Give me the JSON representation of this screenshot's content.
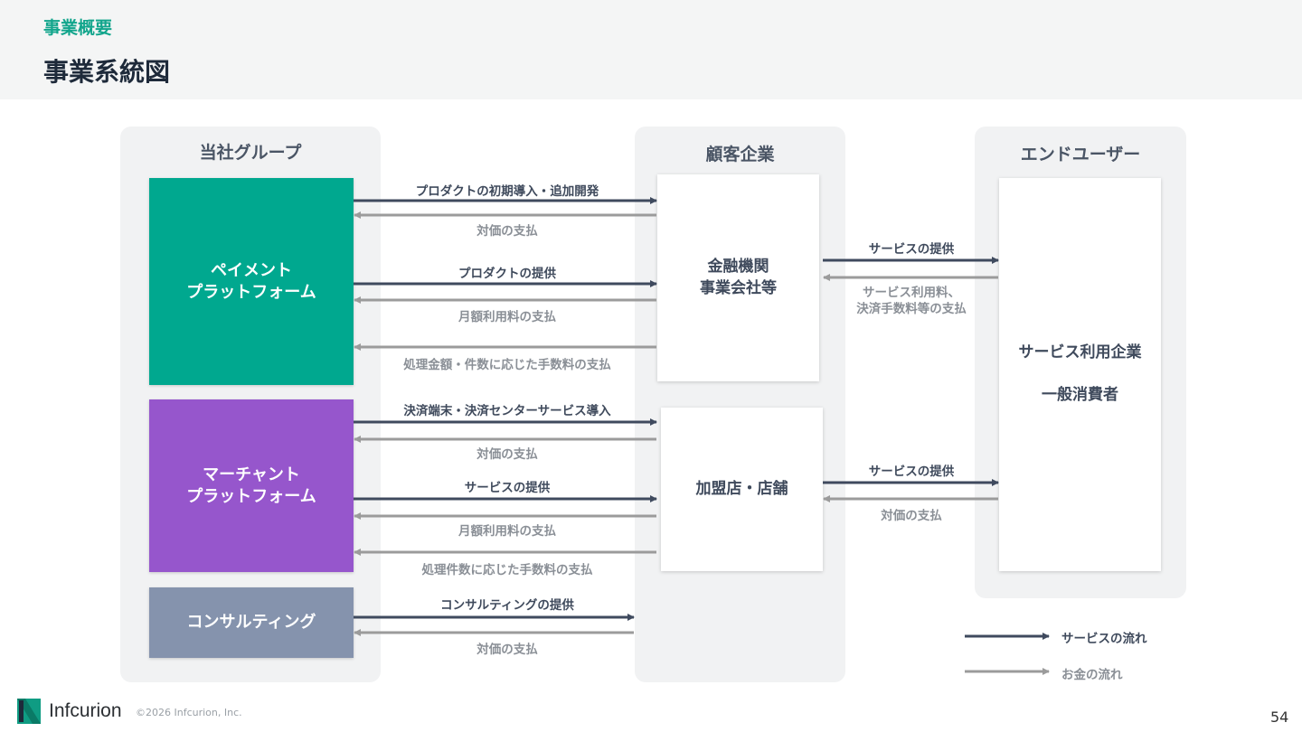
{
  "header": {
    "section": "事業概要",
    "title": "事業系統図"
  },
  "panels": {
    "group": "当社グループ",
    "customer": "顧客企業",
    "enduser": "エンドユーザー"
  },
  "blocks": {
    "payment": "ペイメント\nプラットフォーム",
    "merchant": "マーチャント\nプラットフォーム",
    "consulting": "コンサルティング"
  },
  "boxes": {
    "finance": "金融機関\n事業会社等",
    "store": "加盟店・店舗",
    "enduser": "サービス利用企業\n\n一般消費者"
  },
  "labels": {
    "a1": "プロダクトの初期導入・追加開発",
    "a2": "対価の支払",
    "a3": "プロダクトの提供",
    "a4": "月額利用料の支払",
    "a5": "処理金額・件数に応じた手数料の支払",
    "b1": "決済端末・決済センターサービス導入",
    "b2": "対価の支払",
    "b3": "サービスの提供",
    "b4": "月額利用料の支払",
    "b5": "処理件数に応じた手数料の支払",
    "c1": "コンサルティングの提供",
    "c2": "対価の支払",
    "d1": "サービスの提供",
    "d2": "サービス利用料、\n決済手数料等の支払",
    "e1": "サービスの提供",
    "e2": "対価の支払"
  },
  "legend": {
    "service": "サービスの流れ",
    "money": "お金の流れ"
  },
  "footer": {
    "logo": "Infcurion",
    "copyright": "©2026 Infcurion, Inc.",
    "page": "54"
  },
  "colors": {
    "teal": "#00a88f",
    "purple": "#9656cc",
    "slate": "#8593ad",
    "service_arrow": "#3f4a5e",
    "money_arrow": "#9b9b9b"
  }
}
